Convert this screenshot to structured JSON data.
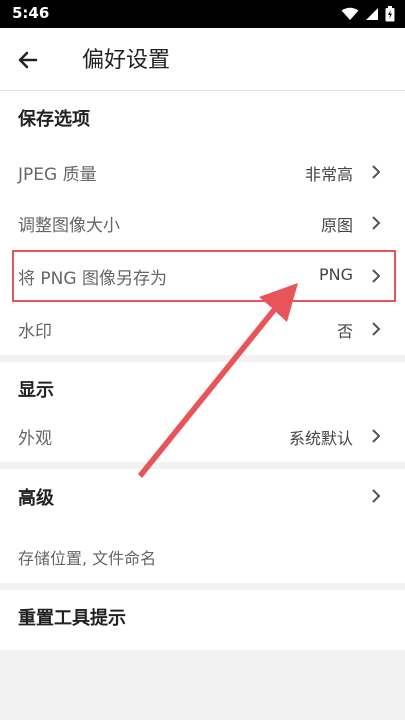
{
  "status_bar": {
    "time": "5:46",
    "icons": [
      "wifi-icon",
      "signal-icon",
      "battery-charging-icon"
    ]
  },
  "app_bar": {
    "back_icon": "arrow-left-icon",
    "title": "偏好设置"
  },
  "sections": {
    "save": {
      "title": "保存选项",
      "rows": [
        {
          "label": "JPEG 质量",
          "value": "非常高"
        },
        {
          "label": "调整图像大小",
          "value": "原图"
        },
        {
          "label": "将 PNG 图像另存为",
          "value": "PNG"
        },
        {
          "label": "水印",
          "value": "否"
        }
      ]
    },
    "display": {
      "title": "显示",
      "rows": [
        {
          "label": "外观",
          "value": "系统默认"
        }
      ]
    },
    "advanced": {
      "title": "高级",
      "subtitle": "存储位置, 文件命名"
    },
    "reset": {
      "title": "重置工具提示"
    }
  },
  "annotation": {
    "highlight_color": "#e8545a",
    "arrow_color": "#e8545a"
  }
}
